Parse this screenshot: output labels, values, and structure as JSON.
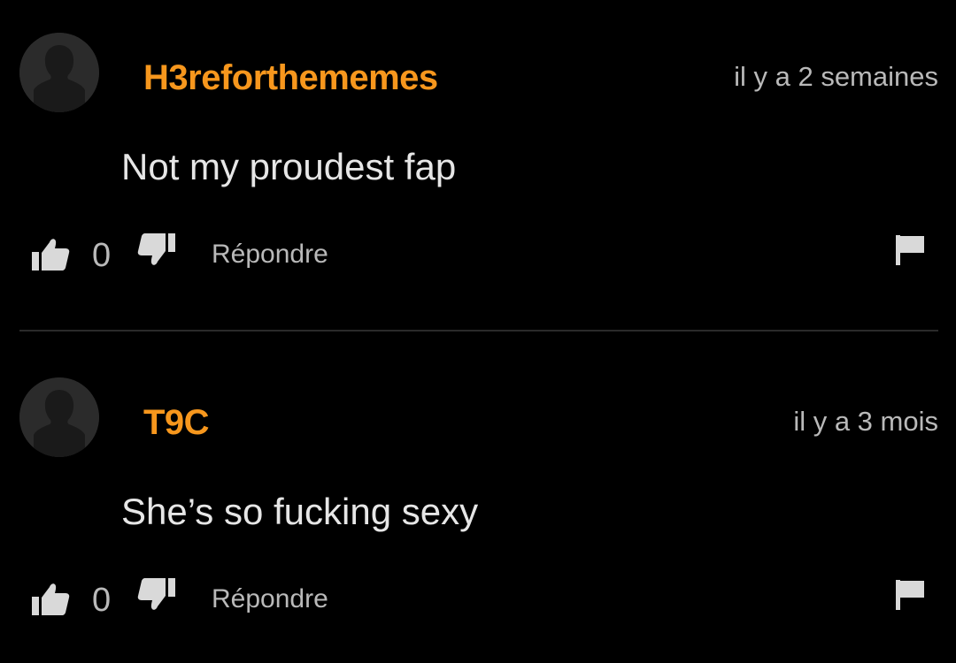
{
  "colors": {
    "background": "#000000",
    "username": "#f7971d",
    "body_text": "#e6e6e6",
    "muted_text": "#b9b9b9",
    "avatar_bg": "#2b2b2b",
    "divider": "#2a2a2a"
  },
  "comments": [
    {
      "username": "H3reforthememes",
      "timestamp": "il y a 2 semaines",
      "text": "Not my proudest fap",
      "vote_count": "0",
      "reply_label": "Répondre",
      "icons": {
        "avatar": "default-avatar-icon",
        "like": "thumbs-up-icon",
        "dislike": "thumbs-down-icon",
        "flag": "flag-icon"
      }
    },
    {
      "username": "T9C",
      "timestamp": "il y a 3 mois",
      "text": "She’s so fucking sexy",
      "vote_count": "0",
      "reply_label": "Répondre",
      "icons": {
        "avatar": "default-avatar-icon",
        "like": "thumbs-up-icon",
        "dislike": "thumbs-down-icon",
        "flag": "flag-icon"
      }
    }
  ]
}
